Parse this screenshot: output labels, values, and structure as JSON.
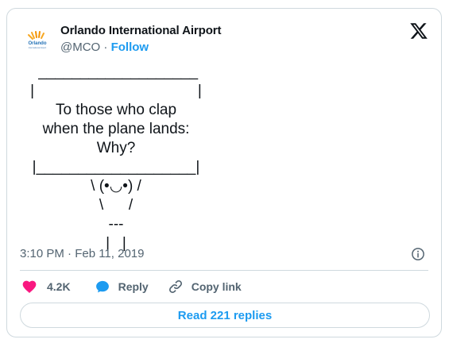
{
  "author": {
    "name": "Orlando International Airport",
    "handle": "@MCO",
    "separator": "·",
    "follow_label": "Follow",
    "avatar_logo_text": "Orlando",
    "avatar_logo_subtext": "International Airport"
  },
  "tweet": {
    "text": " ___________________\n|                                       |\nTo those who clap\nwhen the plane lands:\nWhy?\n|___________________|\n\\ (•◡•) /\n\\      /\n---\n|   |",
    "timestamp": "3:10 PM · Feb 11, 2019"
  },
  "actions": {
    "like_count": "4.2K",
    "reply_label": "Reply",
    "copy_link_label": "Copy link"
  },
  "read_replies_label": "Read 221 replies",
  "colors": {
    "like": "#f91880",
    "reply": "#1d9bf0",
    "link": "#1d9bf0",
    "border": "#cfd9de",
    "secondary_text": "#536471"
  },
  "icons": [
    "orlando-airport-logo",
    "x-logo-icon",
    "info-icon",
    "heart-icon",
    "reply-bubble-icon",
    "link-icon"
  ]
}
